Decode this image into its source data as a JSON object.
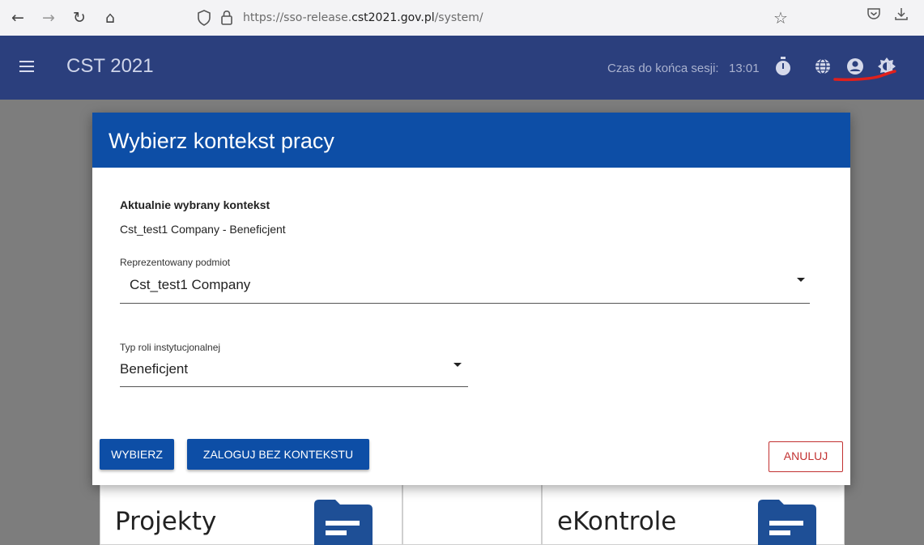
{
  "browser": {
    "url_prefix": "https://sso-release.",
    "url_domain": "cst2021.gov.pl",
    "url_path": "/system/"
  },
  "app": {
    "title": "CST 2021",
    "session_label": "Czas do końca sesji:",
    "session_time": "13:01",
    "header_color": "#2b3f7d"
  },
  "dialog": {
    "title": "Wybierz kontekst pracy",
    "current_context_label": "Aktualnie wybrany kontekst",
    "current_context_value": "Cst_test1 Company - Beneficjent",
    "entity_field": {
      "label": "Reprezentowany podmiot",
      "value": "Cst_test1 Company"
    },
    "role_field": {
      "label": "Typ roli instytucjonalnej",
      "value": "Beneficjent"
    },
    "buttons": {
      "select": "WYBIERZ",
      "login_without_context": "ZALOGUJ BEZ KONTEKSTU",
      "cancel": "ANULUJ"
    },
    "header_color": "#0d4ea6"
  },
  "background_cards": {
    "projects": "Projekty",
    "controls": "eKontrole"
  }
}
